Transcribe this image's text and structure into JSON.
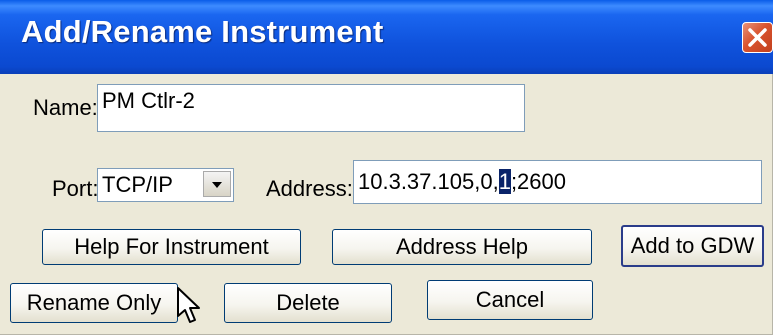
{
  "window": {
    "title": "Add/Rename Instrument",
    "close_icon": "close-icon"
  },
  "form": {
    "name_label": "Name:",
    "name_value": "PM Ctlr-2",
    "port_label": "Port:",
    "port_value": "TCP/IP",
    "address_label": "Address:",
    "address_before": "10.3.37.105,0,",
    "address_selected": "1",
    "address_after": ";2600"
  },
  "buttons": {
    "help_instrument": "Help For Instrument",
    "address_help": "Address Help",
    "add_gdw": "Add to GDW",
    "rename_only": "Rename Only",
    "delete": "Delete",
    "cancel": "Cancel"
  },
  "colors": {
    "titlebar": "#0b49d0",
    "dialog": "#ece9d8",
    "selection": "#0a246a"
  }
}
